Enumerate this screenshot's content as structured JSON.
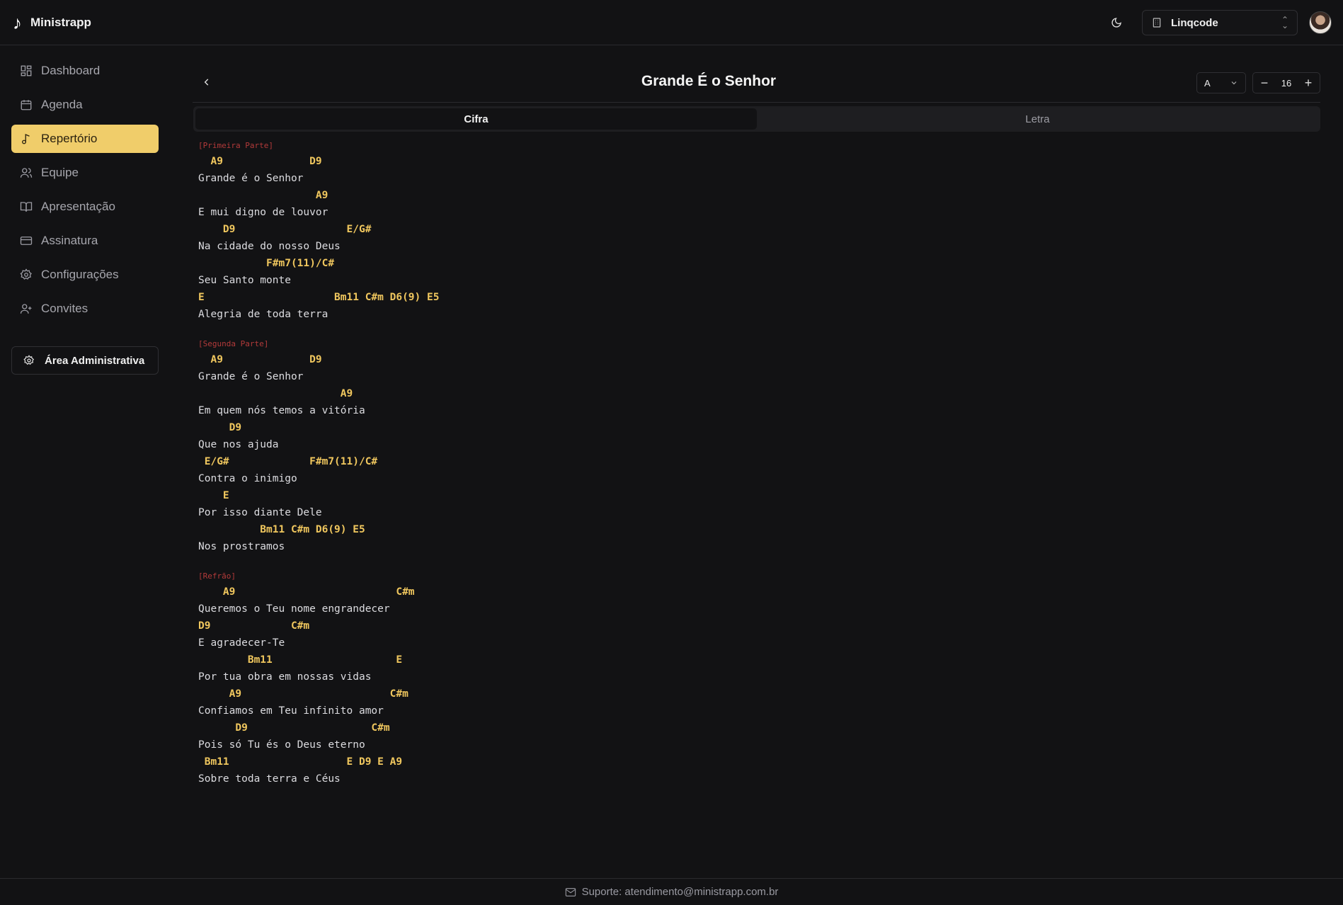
{
  "app": {
    "name": "Ministrapp"
  },
  "header": {
    "workspace": "Linqcode"
  },
  "sidebar": {
    "items": [
      {
        "label": "Dashboard",
        "icon": "dashboard-icon",
        "active": false
      },
      {
        "label": "Agenda",
        "icon": "calendar-icon",
        "active": false
      },
      {
        "label": "Repertório",
        "icon": "music-note-icon",
        "active": true
      },
      {
        "label": "Equipe",
        "icon": "users-icon",
        "active": false
      },
      {
        "label": "Apresentação",
        "icon": "book-icon",
        "active": false
      },
      {
        "label": "Assinatura",
        "icon": "credit-card-icon",
        "active": false
      },
      {
        "label": "Configurações",
        "icon": "gear-icon",
        "active": false
      },
      {
        "label": "Convites",
        "icon": "user-plus-icon",
        "active": false
      }
    ],
    "admin_label": "Área Administrativa"
  },
  "song": {
    "title": "Grande É o Senhor",
    "key": "A",
    "font_size": "16"
  },
  "tabs": [
    {
      "label": "Cifra",
      "active": true
    },
    {
      "label": "Letra",
      "active": false
    }
  ],
  "sections": [
    {
      "label": "[Primeira Parte]",
      "lines": [
        {
          "t": "c",
          "text": "  A9              D9"
        },
        {
          "t": "l",
          "text": "Grande é o Senhor"
        },
        {
          "t": "c",
          "text": "                   A9"
        },
        {
          "t": "l",
          "text": "E mui digno de louvor"
        },
        {
          "t": "c",
          "text": "    D9                  E/G#"
        },
        {
          "t": "l",
          "text": "Na cidade do nosso Deus"
        },
        {
          "t": "c",
          "text": "           F#m7(11)/C#"
        },
        {
          "t": "l",
          "text": "Seu Santo monte"
        },
        {
          "t": "c",
          "text": "E                     Bm11 C#m D6(9) E5"
        },
        {
          "t": "l",
          "text": "Alegria de toda terra"
        }
      ]
    },
    {
      "label": "[Segunda Parte]",
      "lines": [
        {
          "t": "c",
          "text": "  A9              D9"
        },
        {
          "t": "l",
          "text": "Grande é o Senhor"
        },
        {
          "t": "c",
          "text": "                       A9"
        },
        {
          "t": "l",
          "text": "Em quem nós temos a vitória"
        },
        {
          "t": "c",
          "text": "     D9"
        },
        {
          "t": "l",
          "text": "Que nos ajuda"
        },
        {
          "t": "c",
          "text": " E/G#             F#m7(11)/C#"
        },
        {
          "t": "l",
          "text": "Contra o inimigo"
        },
        {
          "t": "c",
          "text": "    E"
        },
        {
          "t": "l",
          "text": "Por isso diante Dele"
        },
        {
          "t": "c",
          "text": "          Bm11 C#m D6(9) E5"
        },
        {
          "t": "l",
          "text": "Nos prostramos"
        }
      ]
    },
    {
      "label": "[Refrão]",
      "lines": [
        {
          "t": "c",
          "text": "    A9                          C#m"
        },
        {
          "t": "l",
          "text": "Queremos o Teu nome engrandecer"
        },
        {
          "t": "c",
          "text": "D9             C#m"
        },
        {
          "t": "l",
          "text": "E agradecer-Te"
        },
        {
          "t": "c",
          "text": "        Bm11                    E"
        },
        {
          "t": "l",
          "text": "Por tua obra em nossas vidas"
        },
        {
          "t": "c",
          "text": "     A9                        C#m"
        },
        {
          "t": "l",
          "text": "Confiamos em Teu infinito amor"
        },
        {
          "t": "c",
          "text": "      D9                    C#m"
        },
        {
          "t": "l",
          "text": "Pois só Tu és o Deus eterno"
        },
        {
          "t": "c",
          "text": " Bm11                   E D9 E A9"
        },
        {
          "t": "l",
          "text": "Sobre toda terra e Céus"
        }
      ]
    }
  ],
  "footer": {
    "support": "Suporte: atendimento@ministrapp.com.br"
  },
  "colors": {
    "accent": "#f0cd6a",
    "chord": "#f0c75e",
    "section_label": "#b33a3a",
    "background": "#121214"
  }
}
